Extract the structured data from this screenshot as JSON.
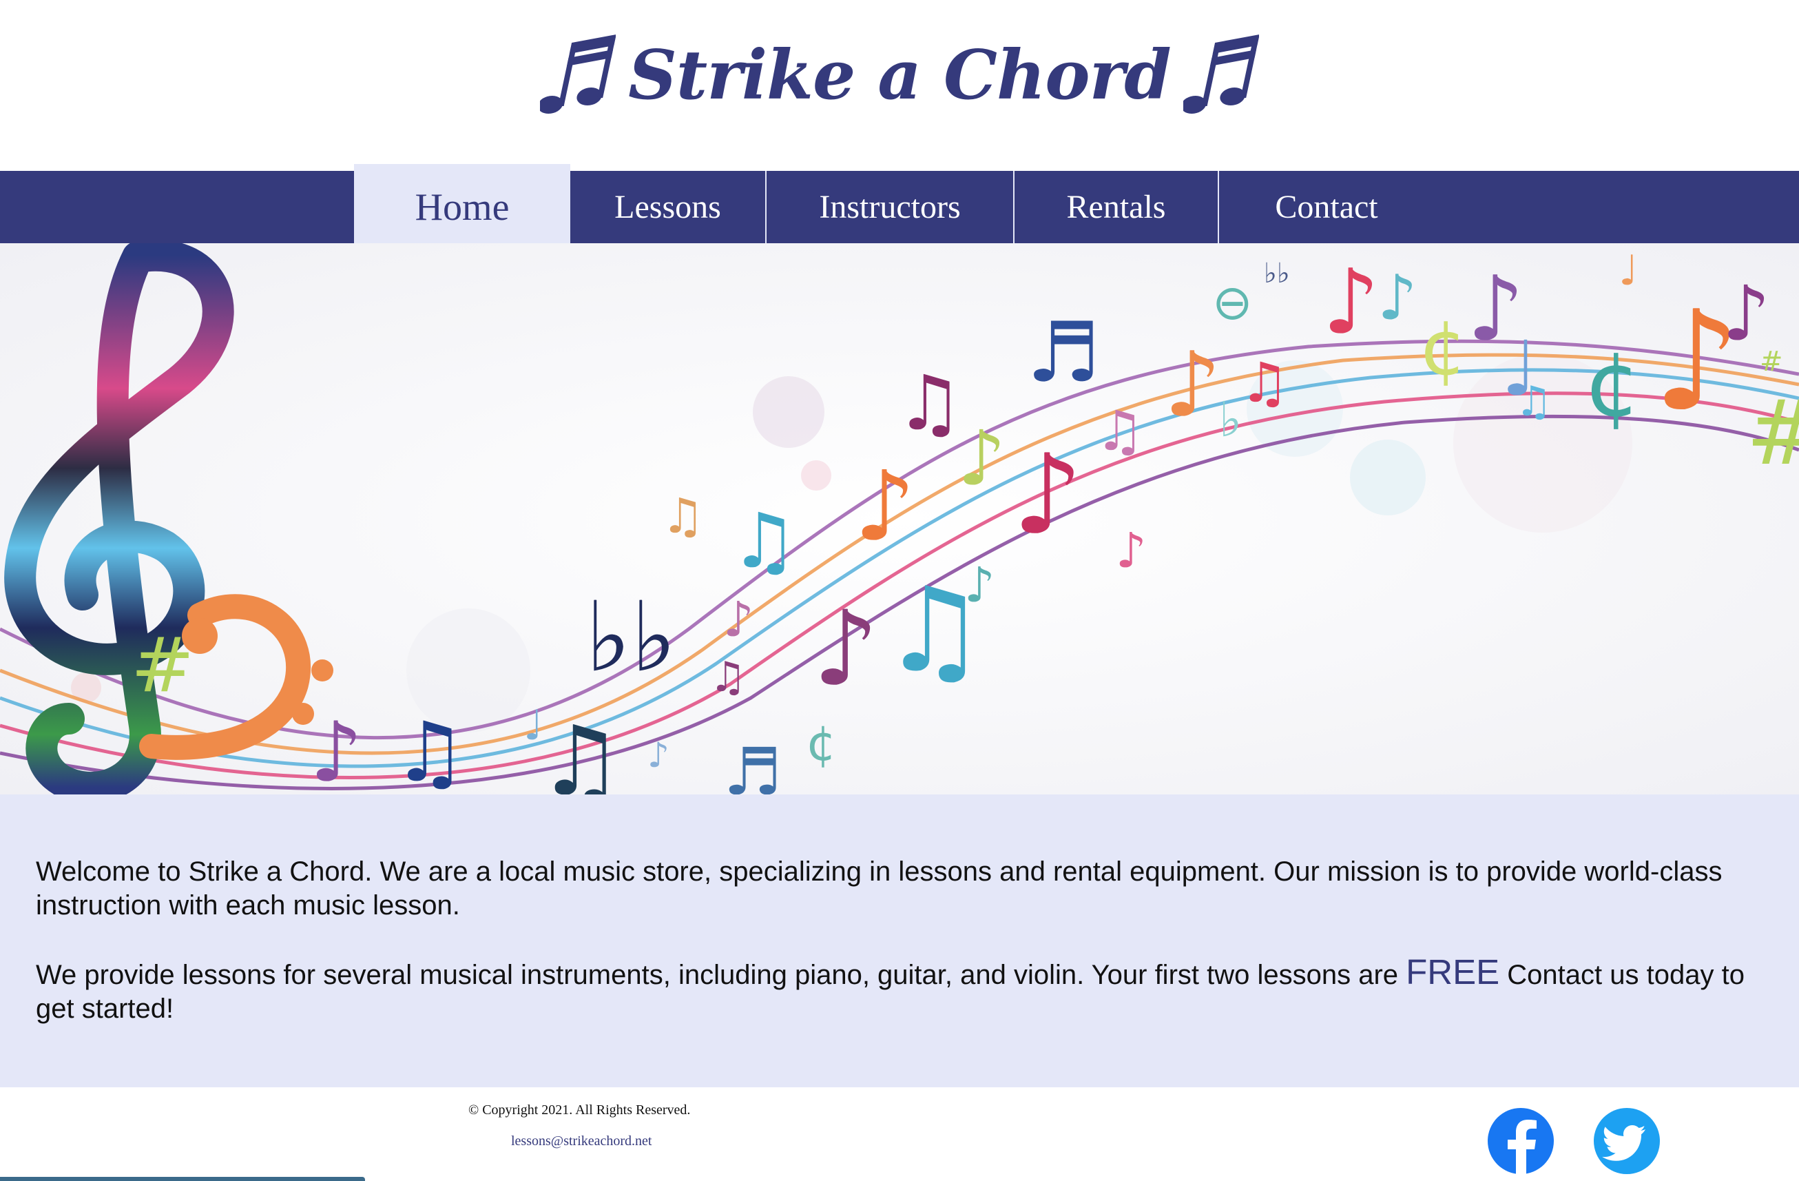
{
  "header": {
    "title": "Strike a Chord",
    "brand_color": "#353a7c",
    "icon_left": "music-note-icon",
    "icon_right": "music-note-icon"
  },
  "nav": {
    "items": [
      {
        "label": "Home",
        "active": true
      },
      {
        "label": "Lessons",
        "active": false
      },
      {
        "label": "Instructors",
        "active": false
      },
      {
        "label": "Rentals",
        "active": false
      },
      {
        "label": "Contact",
        "active": false
      }
    ],
    "bar_color": "#353a7c",
    "active_bg": "#e4e7f8"
  },
  "hero": {
    "image": "colorful-music-notes-banner"
  },
  "content": {
    "paragraph1": "Welcome to Strike a Chord. We are a local music store, specializing in lessons and rental equipment. Our mission is to provide world-class instruction with each music lesson.",
    "paragraph2_before": "We provide lessons for several musical instruments, including piano, guitar, and violin. Your first two lessons are ",
    "paragraph2_highlight": "FREE",
    "paragraph2_after": " Contact us today to get started!",
    "background": "#e4e7f8"
  },
  "footer": {
    "copyright": "© Copyright 2021. All Rights Reserved.",
    "email": "lessons@strikeachord.net",
    "social": [
      {
        "name": "facebook-icon",
        "color": "#1877f2"
      },
      {
        "name": "twitter-icon",
        "color": "#1da1f2"
      }
    ]
  }
}
